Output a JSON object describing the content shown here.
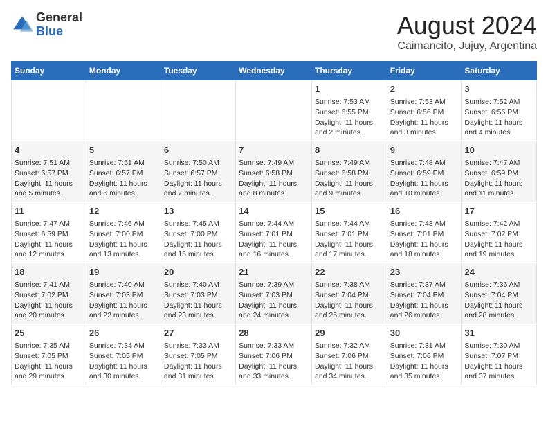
{
  "logo": {
    "general": "General",
    "blue": "Blue"
  },
  "title": "August 2024",
  "location": "Caimancito, Jujuy, Argentina",
  "days_of_week": [
    "Sunday",
    "Monday",
    "Tuesday",
    "Wednesday",
    "Thursday",
    "Friday",
    "Saturday"
  ],
  "weeks": [
    [
      {
        "day": "",
        "info": ""
      },
      {
        "day": "",
        "info": ""
      },
      {
        "day": "",
        "info": ""
      },
      {
        "day": "",
        "info": ""
      },
      {
        "day": "1",
        "info": "Sunrise: 7:53 AM\nSunset: 6:55 PM\nDaylight: 11 hours\nand 2 minutes."
      },
      {
        "day": "2",
        "info": "Sunrise: 7:53 AM\nSunset: 6:56 PM\nDaylight: 11 hours\nand 3 minutes."
      },
      {
        "day": "3",
        "info": "Sunrise: 7:52 AM\nSunset: 6:56 PM\nDaylight: 11 hours\nand 4 minutes."
      }
    ],
    [
      {
        "day": "4",
        "info": "Sunrise: 7:51 AM\nSunset: 6:57 PM\nDaylight: 11 hours\nand 5 minutes."
      },
      {
        "day": "5",
        "info": "Sunrise: 7:51 AM\nSunset: 6:57 PM\nDaylight: 11 hours\nand 6 minutes."
      },
      {
        "day": "6",
        "info": "Sunrise: 7:50 AM\nSunset: 6:57 PM\nDaylight: 11 hours\nand 7 minutes."
      },
      {
        "day": "7",
        "info": "Sunrise: 7:49 AM\nSunset: 6:58 PM\nDaylight: 11 hours\nand 8 minutes."
      },
      {
        "day": "8",
        "info": "Sunrise: 7:49 AM\nSunset: 6:58 PM\nDaylight: 11 hours\nand 9 minutes."
      },
      {
        "day": "9",
        "info": "Sunrise: 7:48 AM\nSunset: 6:59 PM\nDaylight: 11 hours\nand 10 minutes."
      },
      {
        "day": "10",
        "info": "Sunrise: 7:47 AM\nSunset: 6:59 PM\nDaylight: 11 hours\nand 11 minutes."
      }
    ],
    [
      {
        "day": "11",
        "info": "Sunrise: 7:47 AM\nSunset: 6:59 PM\nDaylight: 11 hours\nand 12 minutes."
      },
      {
        "day": "12",
        "info": "Sunrise: 7:46 AM\nSunset: 7:00 PM\nDaylight: 11 hours\nand 13 minutes."
      },
      {
        "day": "13",
        "info": "Sunrise: 7:45 AM\nSunset: 7:00 PM\nDaylight: 11 hours\nand 15 minutes."
      },
      {
        "day": "14",
        "info": "Sunrise: 7:44 AM\nSunset: 7:01 PM\nDaylight: 11 hours\nand 16 minutes."
      },
      {
        "day": "15",
        "info": "Sunrise: 7:44 AM\nSunset: 7:01 PM\nDaylight: 11 hours\nand 17 minutes."
      },
      {
        "day": "16",
        "info": "Sunrise: 7:43 AM\nSunset: 7:01 PM\nDaylight: 11 hours\nand 18 minutes."
      },
      {
        "day": "17",
        "info": "Sunrise: 7:42 AM\nSunset: 7:02 PM\nDaylight: 11 hours\nand 19 minutes."
      }
    ],
    [
      {
        "day": "18",
        "info": "Sunrise: 7:41 AM\nSunset: 7:02 PM\nDaylight: 11 hours\nand 20 minutes."
      },
      {
        "day": "19",
        "info": "Sunrise: 7:40 AM\nSunset: 7:03 PM\nDaylight: 11 hours\nand 22 minutes."
      },
      {
        "day": "20",
        "info": "Sunrise: 7:40 AM\nSunset: 7:03 PM\nDaylight: 11 hours\nand 23 minutes."
      },
      {
        "day": "21",
        "info": "Sunrise: 7:39 AM\nSunset: 7:03 PM\nDaylight: 11 hours\nand 24 minutes."
      },
      {
        "day": "22",
        "info": "Sunrise: 7:38 AM\nSunset: 7:04 PM\nDaylight: 11 hours\nand 25 minutes."
      },
      {
        "day": "23",
        "info": "Sunrise: 7:37 AM\nSunset: 7:04 PM\nDaylight: 11 hours\nand 26 minutes."
      },
      {
        "day": "24",
        "info": "Sunrise: 7:36 AM\nSunset: 7:04 PM\nDaylight: 11 hours\nand 28 minutes."
      }
    ],
    [
      {
        "day": "25",
        "info": "Sunrise: 7:35 AM\nSunset: 7:05 PM\nDaylight: 11 hours\nand 29 minutes."
      },
      {
        "day": "26",
        "info": "Sunrise: 7:34 AM\nSunset: 7:05 PM\nDaylight: 11 hours\nand 30 minutes."
      },
      {
        "day": "27",
        "info": "Sunrise: 7:33 AM\nSunset: 7:05 PM\nDaylight: 11 hours\nand 31 minutes."
      },
      {
        "day": "28",
        "info": "Sunrise: 7:33 AM\nSunset: 7:06 PM\nDaylight: 11 hours\nand 33 minutes."
      },
      {
        "day": "29",
        "info": "Sunrise: 7:32 AM\nSunset: 7:06 PM\nDaylight: 11 hours\nand 34 minutes."
      },
      {
        "day": "30",
        "info": "Sunrise: 7:31 AM\nSunset: 7:06 PM\nDaylight: 11 hours\nand 35 minutes."
      },
      {
        "day": "31",
        "info": "Sunrise: 7:30 AM\nSunset: 7:07 PM\nDaylight: 11 hours\nand 37 minutes."
      }
    ]
  ]
}
